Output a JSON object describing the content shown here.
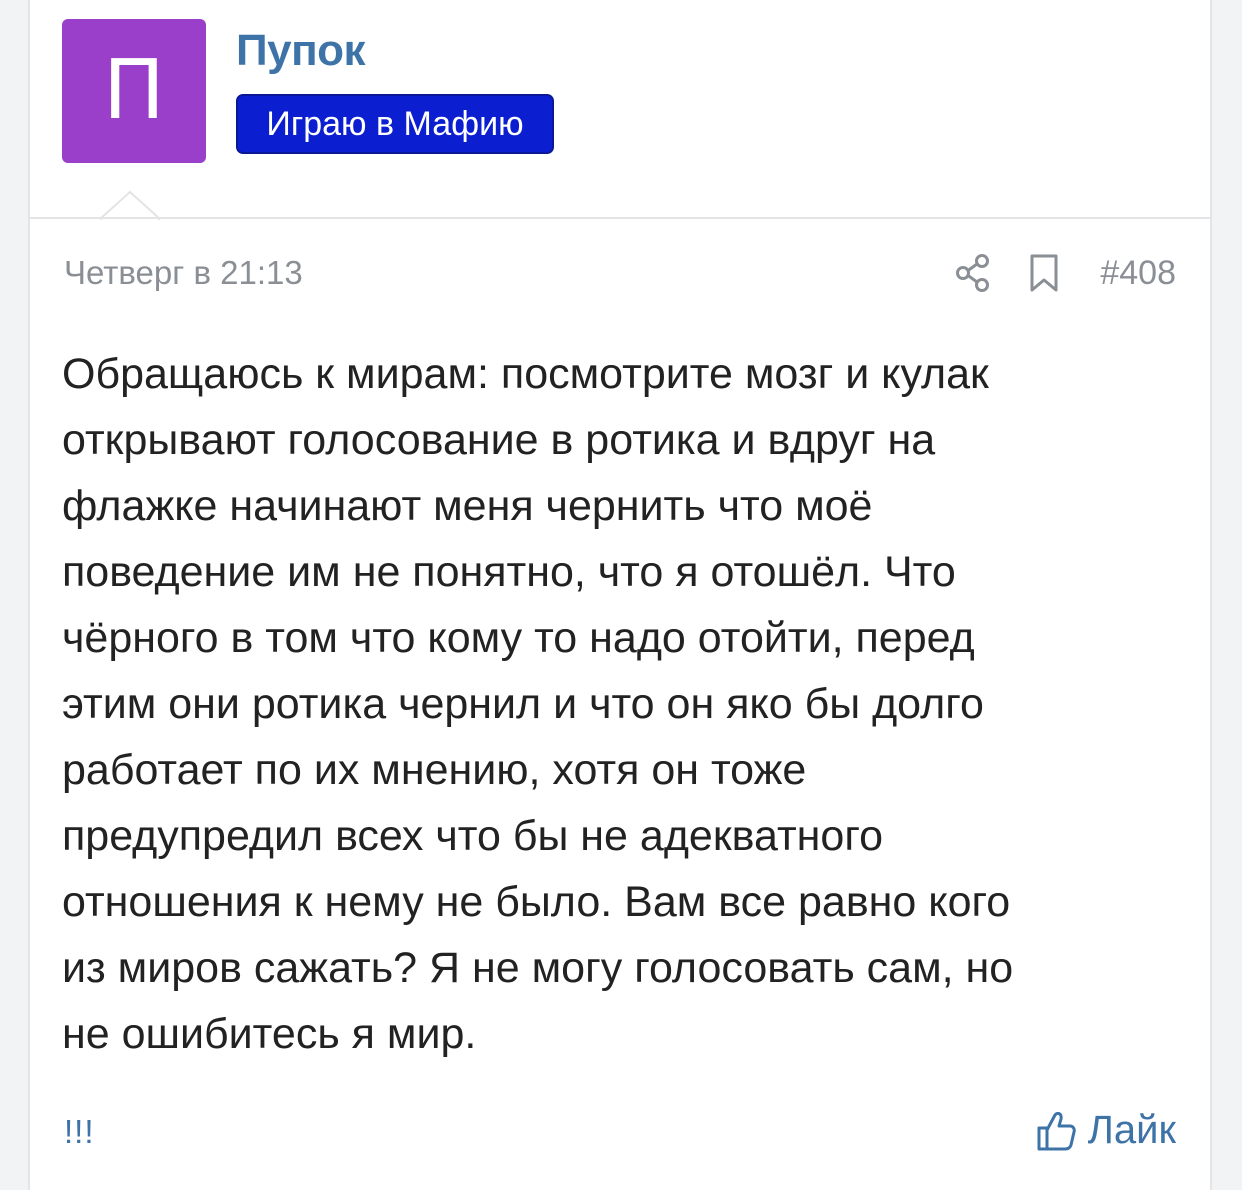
{
  "author": {
    "avatar_letter": "П",
    "avatar_color": "#9a3fca",
    "name": "Пупок",
    "status": "Играю в Мафию",
    "status_color": "#0b1fd1"
  },
  "post": {
    "date": "Четверг в 21:13",
    "number": "#408",
    "text": "Обращаюсь к мирам: посмотрите мозг и кулак\nоткрывают голосование в ротика и вдруг на\nфлажке начинают меня чернить что моё\nповедение им не понятно, что я отошёл. Что\nчёрного в том что кому то надо отойти, перед\nэтим они ротика чернил и что он яко бы долго\nработает по их мнению, хотя он тоже\nпредупредил всех что бы не адекватного\nотношения к нему не было. Вам все равно кого\nиз миров сажать? Я не могу голосовать сам, но\nне ошибитесь я мир.",
    "share_icon": "share-icon",
    "bookmark_icon": "bookmark-icon"
  },
  "footer": {
    "exclaim": "!!!",
    "like_label": "Лайк",
    "like_icon": "thumbs-up-icon",
    "link_color": "#3e73a8"
  }
}
